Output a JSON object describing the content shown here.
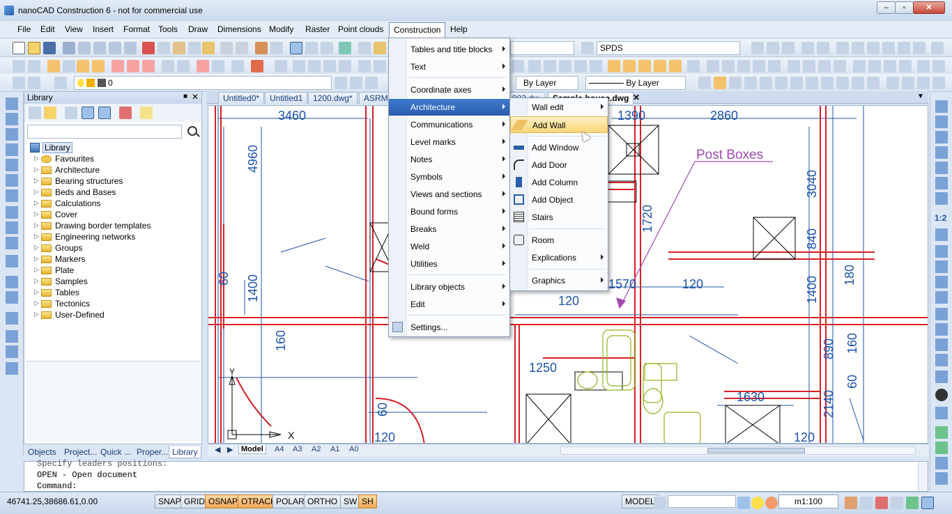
{
  "window": {
    "title": "nanoCAD Construction 6 - not for commercial use",
    "min": "–",
    "max": "▫",
    "close": "✕"
  },
  "menubar": [
    "File",
    "Edit",
    "View",
    "Insert",
    "Format",
    "Tools",
    "Draw",
    "Dimensions",
    "Modify",
    "Raster",
    "Point clouds",
    "Construction",
    "Help"
  ],
  "toolbar": {
    "spds_combo": "SPDS",
    "layer_value": "0",
    "linetype": "By Layer",
    "lineweight": "By Layer"
  },
  "library": {
    "title": "Library",
    "root": "Library",
    "items": [
      "Favourites",
      "Architecture",
      "Bearing structures",
      "Beds and Bases",
      "Calculations",
      "Cover",
      "Drawing border templates",
      "Engineering networks",
      "Groups",
      "Markers",
      "Plate",
      "Samples",
      "Tables",
      "Tectonics",
      "User-Defined"
    ]
  },
  "panel_tabs": [
    "Objects",
    "Project...",
    "Quick ...",
    "Proper...",
    "Library"
  ],
  "doc_tabs": [
    "Untitled0*",
    "Untitled1",
    "1200.dwg*",
    "ASRMF",
    "Sample-house.dwg"
  ],
  "doc_tabs_partial": "002.dw",
  "drawing": {
    "dims": [
      "3460",
      "4960",
      "60",
      "1400",
      "160",
      "1390",
      "2860",
      "3040",
      "1720",
      "840",
      "180",
      "1570",
      "120",
      "120",
      "1400",
      "1250",
      "60",
      "1630",
      "890",
      "160",
      "60",
      "2140",
      "120",
      "120"
    ],
    "annotation": "Post Boxes",
    "axis_y": "Y",
    "axis_x": "X"
  },
  "layout_tabs": [
    "Model",
    "A4",
    "A3",
    "A2",
    "A1",
    "A0"
  ],
  "console": {
    "lines": [
      "Specify leaders positions:",
      "OPEN - Open document",
      "Command:"
    ]
  },
  "status": {
    "coords": "46741.25,38686.61,0.00",
    "toggles": [
      "SNAP",
      "GRID",
      "OSNAP",
      "OTRACK",
      "POLAR",
      "ORTHO",
      "SW",
      "SH"
    ],
    "model": "MODEL",
    "scale": "m1:100"
  },
  "construction_menu": {
    "items": [
      "Tables and title blocks",
      "Text",
      "Coordinate axes",
      "Architecture",
      "Communications",
      "Level marks",
      "Notes",
      "Symbols",
      "Views and sections",
      "Bound forms",
      "Breaks",
      "Weld",
      "Utilities",
      "Library objects",
      "Edit",
      "Settings..."
    ]
  },
  "architecture_menu": {
    "items": [
      "Wall edit",
      "Add Wall",
      "Add Window",
      "Add Door",
      "Add Column",
      "Add Object",
      "Stairs",
      "Room",
      "Explications",
      "Graphics"
    ]
  },
  "side_labels": {
    "ratio": "1:2"
  }
}
